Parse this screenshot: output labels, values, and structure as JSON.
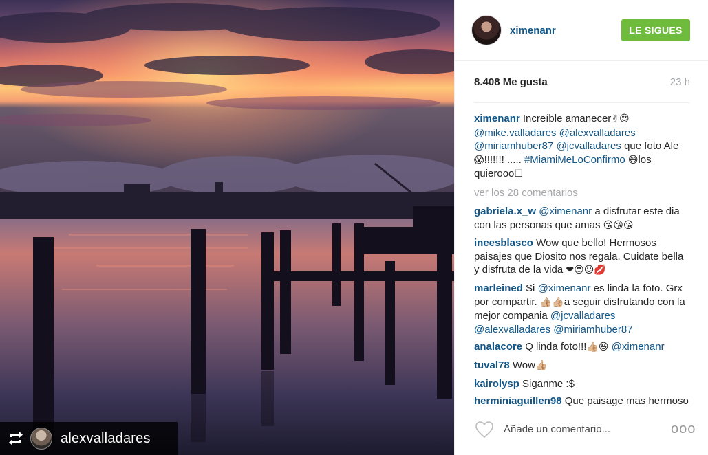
{
  "photo": {
    "description_icon": "repost-icon",
    "repost_user": "alexvalladares"
  },
  "header": {
    "username": "ximenanr",
    "follow_label": "LE SIGUES",
    "follow_color": "#6fbb3c"
  },
  "meta": {
    "likes": "8.408 Me gusta",
    "time": "23 h"
  },
  "caption": {
    "user": "ximenanr",
    "text_1": "Increíble amanecer",
    "emoji_1": "✌😍",
    "mention_1": "@mike.valladares",
    "mention_2": "@alexvalladares",
    "mention_3": "@miriamhuber87",
    "mention_4": "@jcvalladares",
    "text_2": "que foto Ale",
    "emoji_2": "😱",
    "text_3": "!!!!!!! .....",
    "hashtag": "#MiamiMeLoConfirmo",
    "emoji_3": "😅",
    "text_4": "los quierooo",
    "emoji_4": "☐"
  },
  "view_all": "ver los 28 comentarios",
  "comments": [
    {
      "user": "gabriela.x_w",
      "mention": "@ximenanr",
      "text": "a disfrutar este dia con las personas que amas",
      "emoji": "😘😘😘"
    },
    {
      "user": "ineesblasco",
      "text": "Wow que bello! Hermosos paisajes que Diosito nos regala. Cuidate bella y disfruta de la vida",
      "emoji": "❤😍☺💋"
    },
    {
      "user": "marleined",
      "text_a": "Si",
      "mention": "@ximenanr",
      "text_b": "es linda la foto. Grx por compartir.",
      "emoji": "👍🏼👍🏼",
      "text_c": "a seguir disfrutando con la mejor compania",
      "mention_2": "@jcvalladares",
      "mention_3": "@alexvalladares",
      "mention_4": "@miriamhuber87"
    },
    {
      "user": "analacore",
      "text": "Q linda foto!!!",
      "emoji": "👍🏼😃",
      "mention": "@ximenanr"
    },
    {
      "user": "tuval78",
      "text": "Wow",
      "emoji": "👍🏼"
    },
    {
      "user": "kairolysp",
      "text": "Siganme :$"
    },
    {
      "user": "herminiaguillen98",
      "text": "Que paisage mas hermoso"
    }
  ],
  "footer": {
    "add_comment_placeholder": "Añade un comentario...",
    "more_label": "ooo"
  }
}
